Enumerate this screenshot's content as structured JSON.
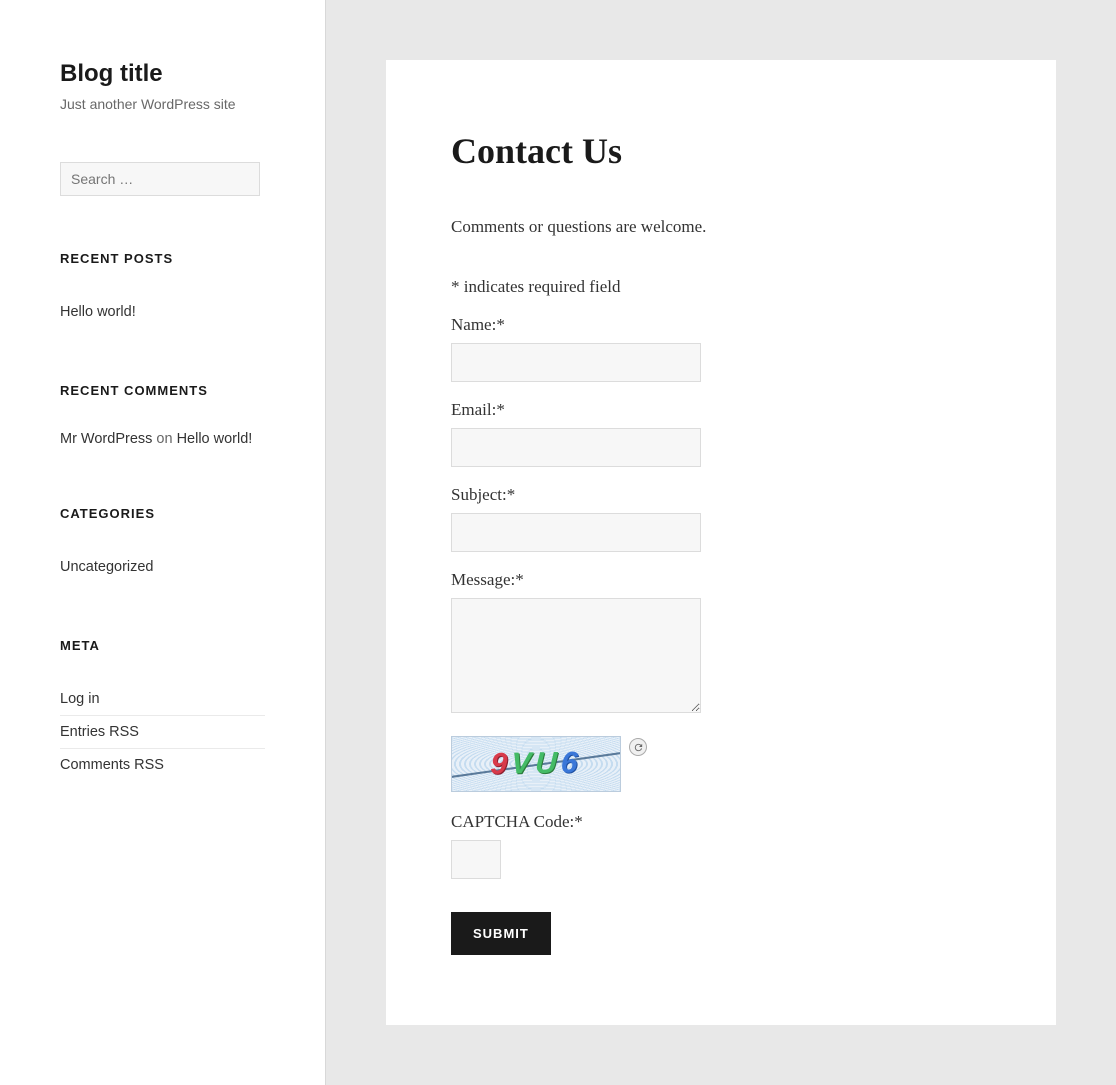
{
  "site": {
    "title": "Blog title",
    "tagline": "Just another WordPress site"
  },
  "search": {
    "placeholder": "Search …"
  },
  "widgets": {
    "recent_posts": {
      "title": "RECENT POSTS",
      "items": [
        "Hello world!"
      ]
    },
    "recent_comments": {
      "title": "RECENT COMMENTS",
      "items": [
        {
          "author": "Mr WordPress",
          "on": " on ",
          "post": "Hello world!"
        }
      ]
    },
    "categories": {
      "title": "CATEGORIES",
      "items": [
        "Uncategorized"
      ]
    },
    "meta": {
      "title": "META",
      "items": [
        "Log in",
        "Entries RSS",
        "Comments RSS"
      ]
    }
  },
  "page": {
    "title": "Contact Us",
    "intro": "Comments or questions are welcome.",
    "required_note": "* indicates required field",
    "fields": {
      "name_label": "Name:*",
      "email_label": "Email:*",
      "subject_label": "Subject:*",
      "message_label": "Message:*",
      "captcha_label": "CAPTCHA Code:*"
    },
    "captcha_value": "9VU6",
    "submit_label": "SUBMIT"
  }
}
